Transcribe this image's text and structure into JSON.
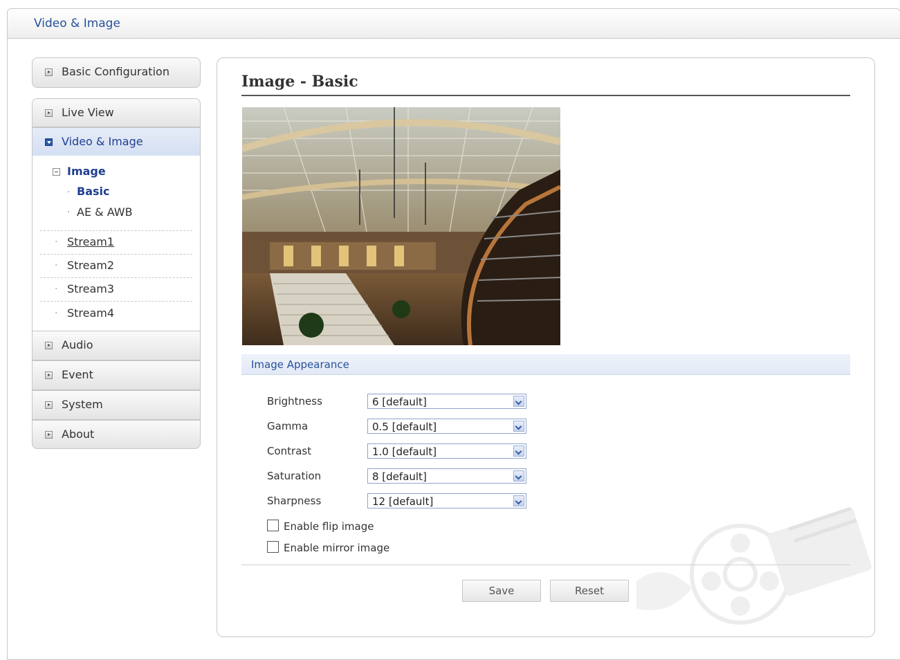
{
  "header": {
    "title": "Video & Image"
  },
  "sidebar": {
    "basic_configuration": "Basic Configuration",
    "live_view": "Live View",
    "video_image": "Video & Image",
    "tree": {
      "image": "Image",
      "basic": "Basic",
      "ae_awb": "AE & AWB",
      "streams": [
        "Stream1",
        "Stream2",
        "Stream3",
        "Stream4"
      ]
    },
    "audio": "Audio",
    "event": "Event",
    "system": "System",
    "about": "About"
  },
  "main": {
    "heading": "Image - Basic",
    "section_title": "Image Appearance",
    "fields": [
      {
        "label": "Brightness",
        "value": "6 [default]"
      },
      {
        "label": "Gamma",
        "value": "0.5 [default]"
      },
      {
        "label": "Contrast",
        "value": "1.0 [default]"
      },
      {
        "label": "Saturation",
        "value": "8 [default]"
      },
      {
        "label": "Sharpness",
        "value": "12 [default]"
      }
    ],
    "flip_label": "Enable flip image",
    "mirror_label": "Enable mirror image",
    "flip_checked": false,
    "mirror_checked": false,
    "save_label": "Save",
    "reset_label": "Reset"
  },
  "colors": {
    "accent": "#26509a",
    "active_bg": "#d4dff3"
  },
  "icons": [
    "collapsed-square-icon",
    "expanded-square-icon",
    "tree-minus-icon",
    "dropdown-arrow-icon",
    "film-reel-icon"
  ]
}
